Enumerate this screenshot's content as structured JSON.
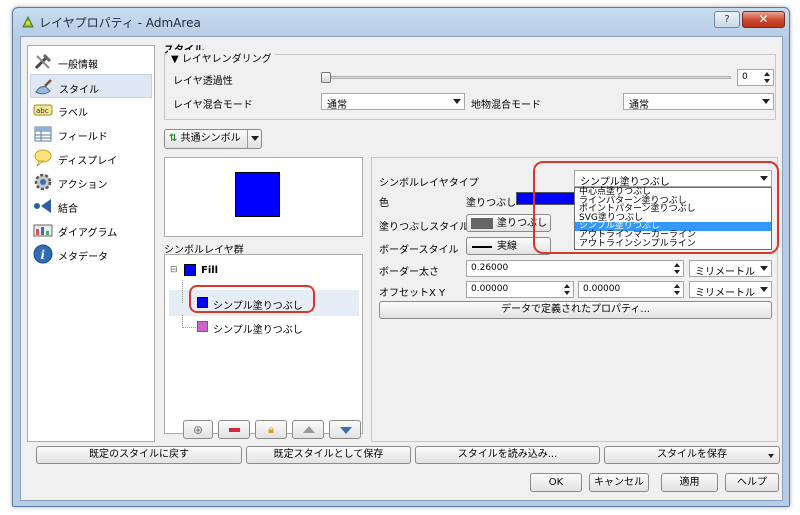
{
  "window": {
    "title": "レイヤプロパティ - AdmArea",
    "help_btn": "?",
    "close_btn": "✕"
  },
  "nav": [
    {
      "label": "一般情報",
      "icon": "tools-icon"
    },
    {
      "label": "スタイル",
      "icon": "paint-brush-icon"
    },
    {
      "label": "ラベル",
      "icon": "label-icon"
    },
    {
      "label": "フィールド",
      "icon": "table-icon"
    },
    {
      "label": "ディスプレイ",
      "icon": "speech-bubble-icon"
    },
    {
      "label": "アクション",
      "icon": "gear-icon"
    },
    {
      "label": "結合",
      "icon": "join-icon"
    },
    {
      "label": "ダイアグラム",
      "icon": "diagram-icon"
    },
    {
      "label": "メタデータ",
      "icon": "info-icon"
    }
  ],
  "style": {
    "heading": "スタイル",
    "rendering_group": "レイヤレンダリング",
    "transparency_label": "レイヤ透過性",
    "transparency_value": "0",
    "blend_label": "レイヤ混合モード",
    "blend_value": "通常",
    "feature_blend_label": "地物混合モード",
    "feature_blend_value": "通常",
    "renderer_value": "共通シンボル",
    "symbol_layers_label": "シンボルレイヤ群",
    "tree": {
      "root": "Fill",
      "child1": "シンプル塗りつぶし",
      "child2": "シンプル塗りつぶし"
    },
    "props": {
      "layer_type_label": "シンボルレイヤタイプ",
      "layer_type_value": "シンプル塗りつぶし",
      "color_label": "色",
      "fill_label": "塗りつぶし",
      "fill_style_label": "塗りつぶしスタイル",
      "fill_style_value": "塗りつぶし",
      "border_style_label": "ボーダースタイル",
      "border_style_value": "実線",
      "border_width_label": "ボーダー太さ",
      "border_width_value": "0.26000",
      "border_unit": "ミリメートル",
      "offset_label": "オフセットX Y",
      "offset_x": "0.00000",
      "offset_y": "0.00000",
      "offset_unit": "ミリメートル",
      "data_defined_btn": "データで定義されたプロパティ..."
    },
    "dropdown_options": [
      "中心点塗りつぶし",
      "ラインパターン塗りつぶし",
      "ポイントパターン塗りつぶし",
      "SVG塗りつぶし",
      "シンプル塗りつぶし",
      "アウトラインマーカーライン",
      "アウトラインシンプルライン"
    ],
    "dropdown_selected_index": 4
  },
  "bottom": {
    "restore_default": "既定のスタイルに戻す",
    "save_default": "既定スタイルとして保存",
    "load_style": "スタイルを読み込み...",
    "save_style": "スタイルを保存",
    "ok": "OK",
    "cancel": "キャンセル",
    "apply": "適用",
    "help": "ヘルプ"
  },
  "colors": {
    "fill": "#0000ff",
    "symbol_layer2": "#cc66cc",
    "highlight": "#3399ff",
    "callout": "#d33a2c"
  }
}
